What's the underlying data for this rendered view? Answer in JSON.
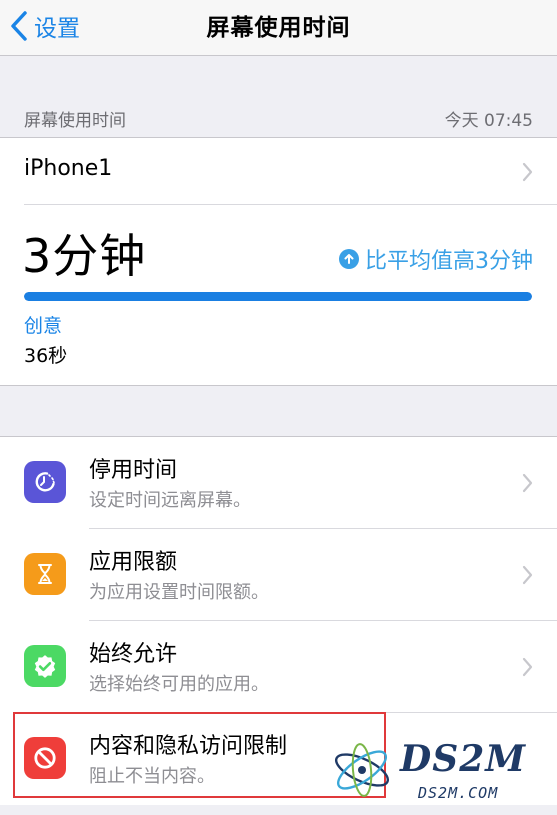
{
  "nav": {
    "back_label": "设置",
    "title": "屏幕使用时间"
  },
  "section": {
    "title": "屏幕使用时间",
    "timestamp": "今天 07:45"
  },
  "summary": {
    "device": "iPhone1",
    "total_time": "3分钟",
    "comparison": "比平均值高3分钟",
    "usage_fraction": 1.0,
    "category_name": "创意",
    "category_time": "36秒"
  },
  "settings": [
    {
      "title": "停用时间",
      "subtitle": "设定时间远离屏幕。",
      "icon": "downtime-icon",
      "color": "#5a55d7"
    },
    {
      "title": "应用限额",
      "subtitle": "为应用设置时间限额。",
      "icon": "hourglass-icon",
      "color": "#f59b1a"
    },
    {
      "title": "始终允许",
      "subtitle": "选择始终可用的应用。",
      "icon": "checkmark-badge-icon",
      "color": "#4cd964"
    },
    {
      "title": "内容和隐私访问限制",
      "subtitle": "阻止不当内容。",
      "icon": "restriction-icon",
      "color": "#ef3e3a"
    }
  ],
  "watermark": {
    "brand": "DS2M",
    "site": "DS2M.COM"
  },
  "colors": {
    "accent": "#1a84e6",
    "highlight_box": "#e0393b"
  }
}
